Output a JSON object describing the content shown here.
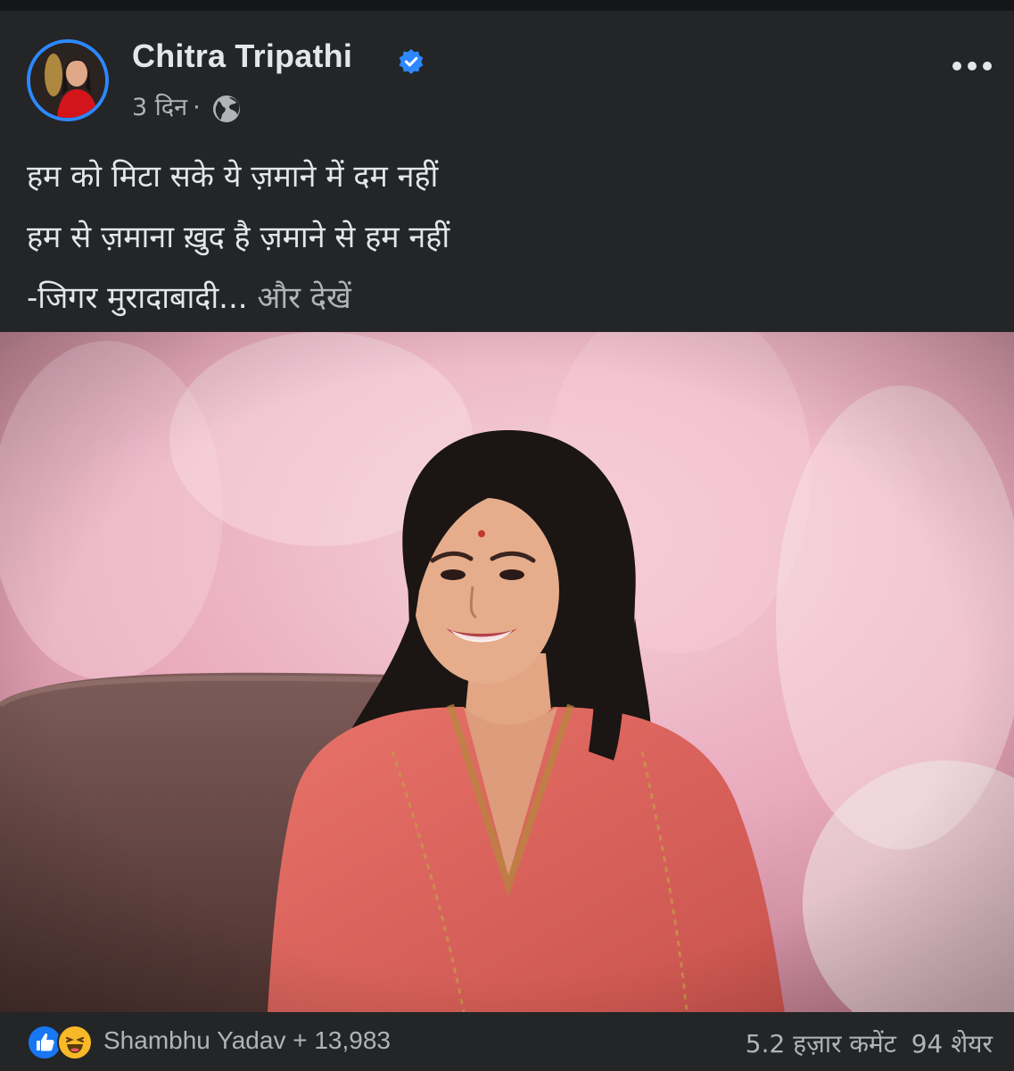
{
  "post": {
    "author": "Chitra Tripathi",
    "time": "3 दिन",
    "dot": "·",
    "caption": {
      "line1": "हम को मिटा सके ये ज़माने में दम नहीं",
      "line2": "हम से ज़माना ख़ुद है ज़माने से हम नहीं",
      "line3": "-जिगर मुरादाबादी...",
      "see_more": "और देखें"
    }
  },
  "reactions": {
    "names": "Shambhu Yadav + 13,983",
    "comments": "5.2 हज़ार कमेंट",
    "shares": "94 शेयर"
  },
  "icons": [
    "verified-badge-icon",
    "globe-icon",
    "more-options-icon",
    "like-reaction-icon",
    "haha-reaction-icon"
  ],
  "colors": {
    "background": "#242526",
    "accent": "#2d88ff",
    "text": "#e4e6eb",
    "muted": "#b0b3b8"
  }
}
